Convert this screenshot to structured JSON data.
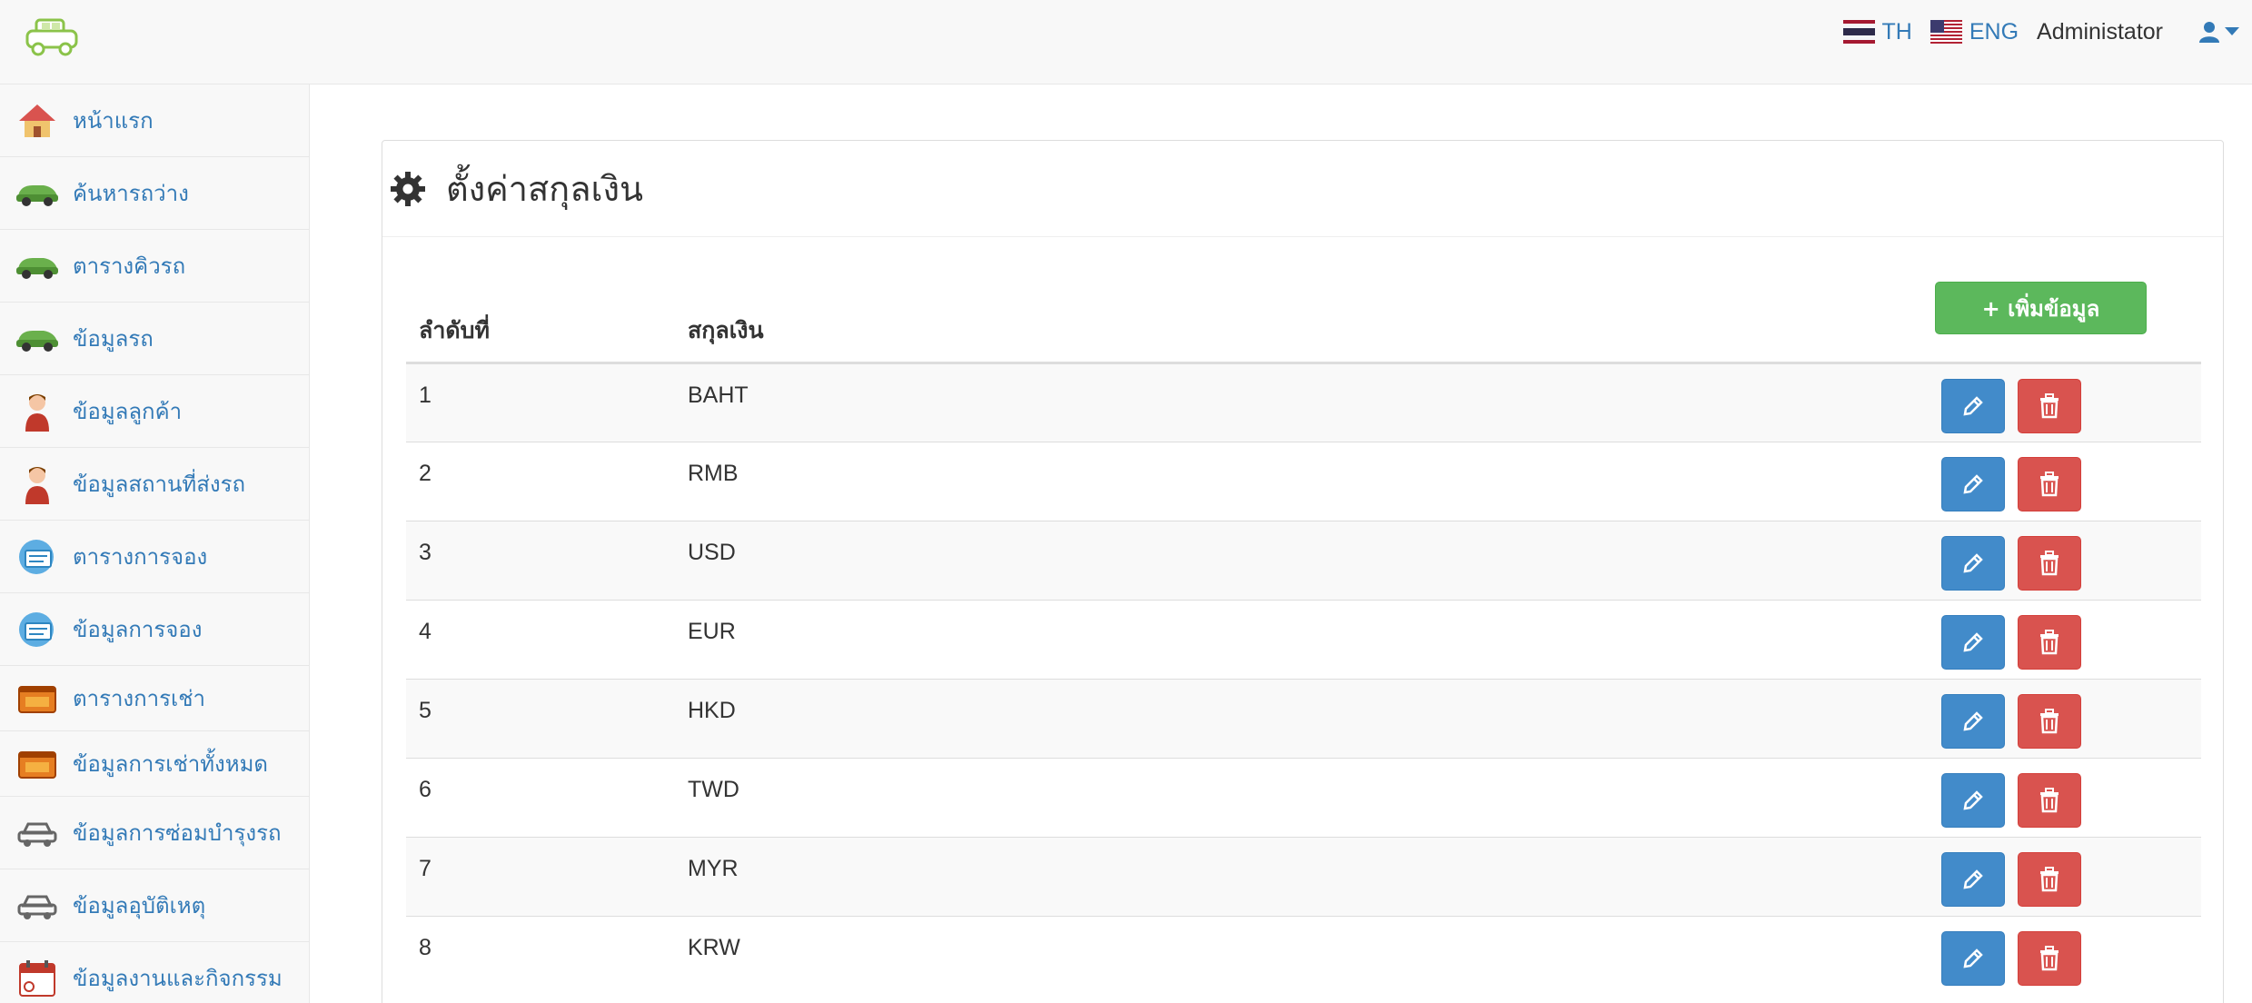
{
  "header": {
    "lang_th": "TH",
    "lang_eng": "ENG",
    "user_name": "Administator",
    "colors": {
      "link": "#337ab7"
    }
  },
  "sidebar": {
    "items": [
      {
        "label": "หน้าแรก",
        "icon": "home-icon"
      },
      {
        "label": "ค้นหารถว่าง",
        "icon": "green-car-icon"
      },
      {
        "label": "ตารางคิวรถ",
        "icon": "green-car-icon"
      },
      {
        "label": "ข้อมูลรถ",
        "icon": "green-car-icon"
      },
      {
        "label": "ข้อมูลลูกค้า",
        "icon": "person-icon"
      },
      {
        "label": "ข้อมูลสถานที่ส่งรถ",
        "icon": "person-icon"
      },
      {
        "label": "ตารางการจอง",
        "icon": "booking-icon"
      },
      {
        "label": "ข้อมูลการจอง",
        "icon": "booking-icon"
      },
      {
        "label": "ตารางการเช่า",
        "icon": "rent-icon"
      },
      {
        "label": "ข้อมูลการเช่าทั้งหมด",
        "icon": "rent-icon"
      },
      {
        "label": "ข้อมูลการซ่อมบำรุงรถ",
        "icon": "gray-car-icon"
      },
      {
        "label": "ข้อมูลอุบัติเหตุ",
        "icon": "gray-car-icon"
      },
      {
        "label": "ข้อมูลงานและกิจกรรม",
        "icon": "calendar-icon"
      }
    ]
  },
  "main": {
    "title": "ตั้งค่าสกุลเงิน",
    "add_button": "+ เพิ่มข้อมูล",
    "columns": [
      "ลำดับที่",
      "สกุลเงิน"
    ],
    "rows": [
      {
        "no": "1",
        "currency": "BAHT"
      },
      {
        "no": "2",
        "currency": "RMB"
      },
      {
        "no": "3",
        "currency": "USD"
      },
      {
        "no": "4",
        "currency": "EUR"
      },
      {
        "no": "5",
        "currency": "HKD"
      },
      {
        "no": "6",
        "currency": "TWD"
      },
      {
        "no": "7",
        "currency": "MYR"
      },
      {
        "no": "8",
        "currency": "KRW"
      }
    ],
    "colors": {
      "edit": "#428bca",
      "delete": "#d9534f",
      "add": "#5cb85c"
    }
  }
}
